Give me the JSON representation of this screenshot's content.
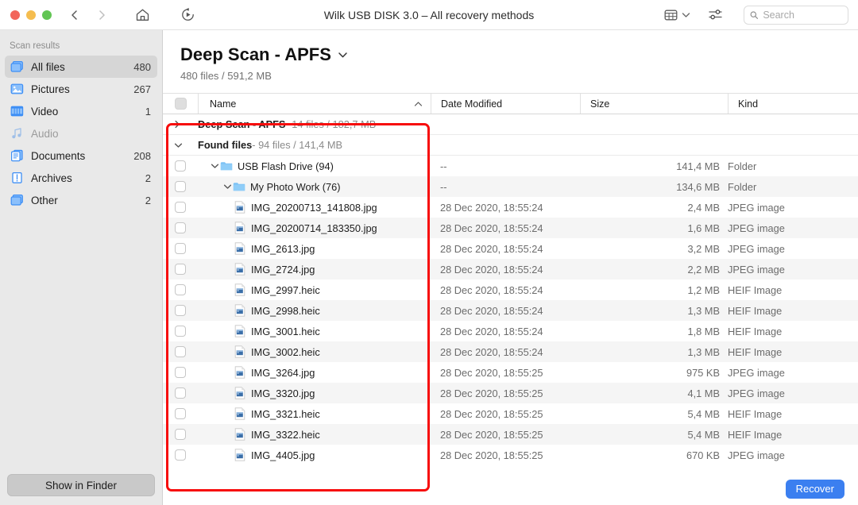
{
  "titlebar": {
    "title": "Wilk USB DISK 3.0 – All recovery methods",
    "back_icon": "chevron-left-icon",
    "forward_icon": "chevron-right-icon",
    "home_icon": "home-icon",
    "rescan_icon": "rescan-play-icon",
    "view_mode_icon": "grid-view-icon",
    "view_mode_chevron": "chevron-down-icon",
    "filter_icon": "filter-sliders-icon",
    "search_icon": "search-icon",
    "search_placeholder": "Search",
    "search_value": ""
  },
  "sidebar": {
    "header": "Scan results",
    "items": [
      {
        "label": "All files",
        "count": "480",
        "icon": "all-files-icon",
        "active": true,
        "dim": false
      },
      {
        "label": "Pictures",
        "count": "267",
        "icon": "pictures-icon",
        "active": false,
        "dim": false
      },
      {
        "label": "Video",
        "count": "1",
        "icon": "video-icon",
        "active": false,
        "dim": false
      },
      {
        "label": "Audio",
        "count": "",
        "icon": "audio-icon",
        "active": false,
        "dim": true
      },
      {
        "label": "Documents",
        "count": "208",
        "icon": "documents-icon",
        "active": false,
        "dim": false
      },
      {
        "label": "Archives",
        "count": "2",
        "icon": "archives-icon",
        "active": false,
        "dim": false
      },
      {
        "label": "Other",
        "count": "2",
        "icon": "other-icon",
        "active": false,
        "dim": false
      }
    ],
    "show_in_finder": "Show in Finder"
  },
  "main": {
    "scan_title": "Deep Scan - APFS",
    "scan_title_chevron": "chevron-down-icon",
    "scan_subtitle": "480 files / 591,2 MB"
  },
  "table": {
    "columns": {
      "name": "Name",
      "date_modified": "Date Modified",
      "size": "Size",
      "kind": "Kind"
    },
    "sort_caret": "sort-ascending-caret-icon",
    "rows": [
      {
        "type": "group",
        "indent": 0,
        "expanded": false,
        "label": "Deep Scan - APFS",
        "meta": " - 14 files / 182,7 MB",
        "date": "",
        "size": "",
        "kind": ""
      },
      {
        "type": "group",
        "indent": 0,
        "expanded": true,
        "label": "Found files",
        "meta": " - 94 files / 141,4 MB",
        "date": "",
        "size": "",
        "kind": ""
      },
      {
        "type": "folder",
        "indent": 1,
        "expanded": true,
        "label": "USB Flash Drive (94)",
        "date": "--",
        "size": "141,4 MB",
        "kind": "Folder"
      },
      {
        "type": "folder",
        "indent": 2,
        "expanded": true,
        "label": "My Photo Work (76)",
        "date": "--",
        "size": "134,6 MB",
        "kind": "Folder"
      },
      {
        "type": "file",
        "indent": 3,
        "label": "IMG_20200713_141808.jpg",
        "date": "28 Dec 2020, 18:55:24",
        "size": "2,4 MB",
        "kind": "JPEG image"
      },
      {
        "type": "file",
        "indent": 3,
        "label": "IMG_20200714_183350.jpg",
        "date": "28 Dec 2020, 18:55:24",
        "size": "1,6 MB",
        "kind": "JPEG image"
      },
      {
        "type": "file",
        "indent": 3,
        "label": "IMG_2613.jpg",
        "date": "28 Dec 2020, 18:55:24",
        "size": "3,2 MB",
        "kind": "JPEG image"
      },
      {
        "type": "file",
        "indent": 3,
        "label": "IMG_2724.jpg",
        "date": "28 Dec 2020, 18:55:24",
        "size": "2,2 MB",
        "kind": "JPEG image"
      },
      {
        "type": "file",
        "indent": 3,
        "label": "IMG_2997.heic",
        "date": "28 Dec 2020, 18:55:24",
        "size": "1,2 MB",
        "kind": "HEIF Image"
      },
      {
        "type": "file",
        "indent": 3,
        "label": "IMG_2998.heic",
        "date": "28 Dec 2020, 18:55:24",
        "size": "1,3 MB",
        "kind": "HEIF Image"
      },
      {
        "type": "file",
        "indent": 3,
        "label": "IMG_3001.heic",
        "date": "28 Dec 2020, 18:55:24",
        "size": "1,8 MB",
        "kind": "HEIF Image"
      },
      {
        "type": "file",
        "indent": 3,
        "label": "IMG_3002.heic",
        "date": "28 Dec 2020, 18:55:24",
        "size": "1,3 MB",
        "kind": "HEIF Image"
      },
      {
        "type": "file",
        "indent": 3,
        "label": "IMG_3264.jpg",
        "date": "28 Dec 2020, 18:55:25",
        "size": "975 KB",
        "kind": "JPEG image"
      },
      {
        "type": "file",
        "indent": 3,
        "label": "IMG_3320.jpg",
        "date": "28 Dec 2020, 18:55:25",
        "size": "4,1 MB",
        "kind": "JPEG image"
      },
      {
        "type": "file",
        "indent": 3,
        "label": "IMG_3321.heic",
        "date": "28 Dec 2020, 18:55:25",
        "size": "5,4 MB",
        "kind": "HEIF Image"
      },
      {
        "type": "file",
        "indent": 3,
        "label": "IMG_3322.heic",
        "date": "28 Dec 2020, 18:55:25",
        "size": "5,4 MB",
        "kind": "HEIF Image"
      },
      {
        "type": "file",
        "indent": 3,
        "label": "IMG_4405.jpg",
        "date": "28 Dec 2020, 18:55:25",
        "size": "670 KB",
        "kind": "JPEG image"
      }
    ]
  },
  "bottombar": {
    "recover": "Recover"
  },
  "annotation": {
    "color": "#f70c0c"
  }
}
